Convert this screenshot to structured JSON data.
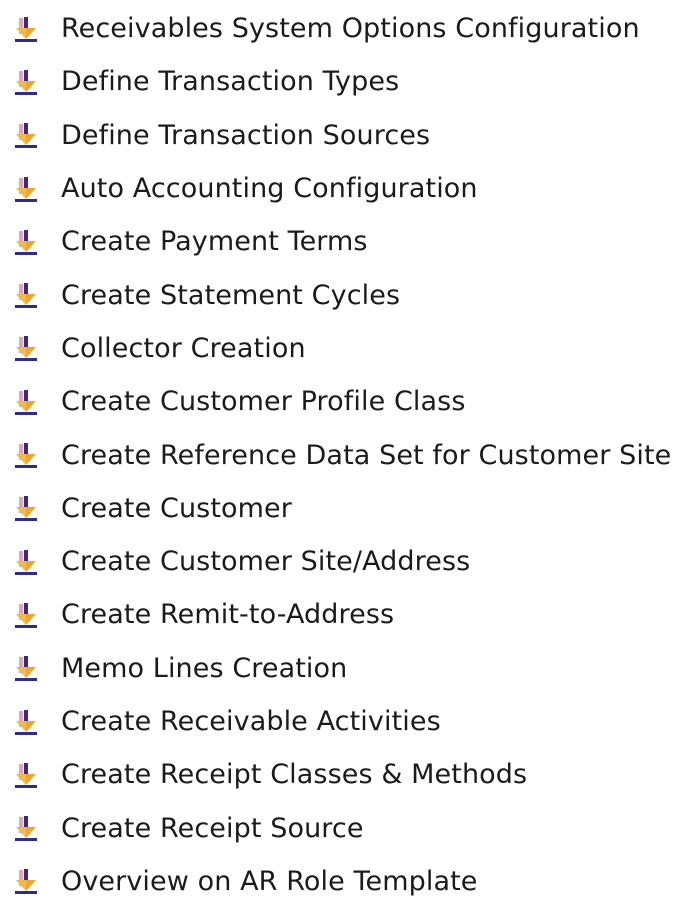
{
  "bullet": {
    "icon": "down-arrow-bullet-icon",
    "colors": {
      "shaft": "#2e2c8c",
      "shadow": "#e9a3b6",
      "head_left": "#f4bb42",
      "head_right": "#f0a53a",
      "underline": "#2e2c8c"
    }
  },
  "items": [
    {
      "label": "Receivables System Options Configuration"
    },
    {
      "label": "Define Transaction Types"
    },
    {
      "label": "Define Transaction Sources"
    },
    {
      "label": "Auto Accounting Configuration"
    },
    {
      "label": "Create Payment Terms"
    },
    {
      "label": "Create Statement Cycles"
    },
    {
      "label": "Collector Creation"
    },
    {
      "label": "Create Customer Profile Class"
    },
    {
      "label": "Create Reference Data Set for Customer Site"
    },
    {
      "label": "Create Customer"
    },
    {
      "label": "Create Customer Site/Address"
    },
    {
      "label": "Create Remit-to-Address"
    },
    {
      "label": "Memo Lines Creation"
    },
    {
      "label": "Create Receivable Activities"
    },
    {
      "label": "Create Receipt Classes & Methods"
    },
    {
      "label": "Create Receipt Source"
    },
    {
      "label": "Overview on AR Role Template"
    }
  ]
}
